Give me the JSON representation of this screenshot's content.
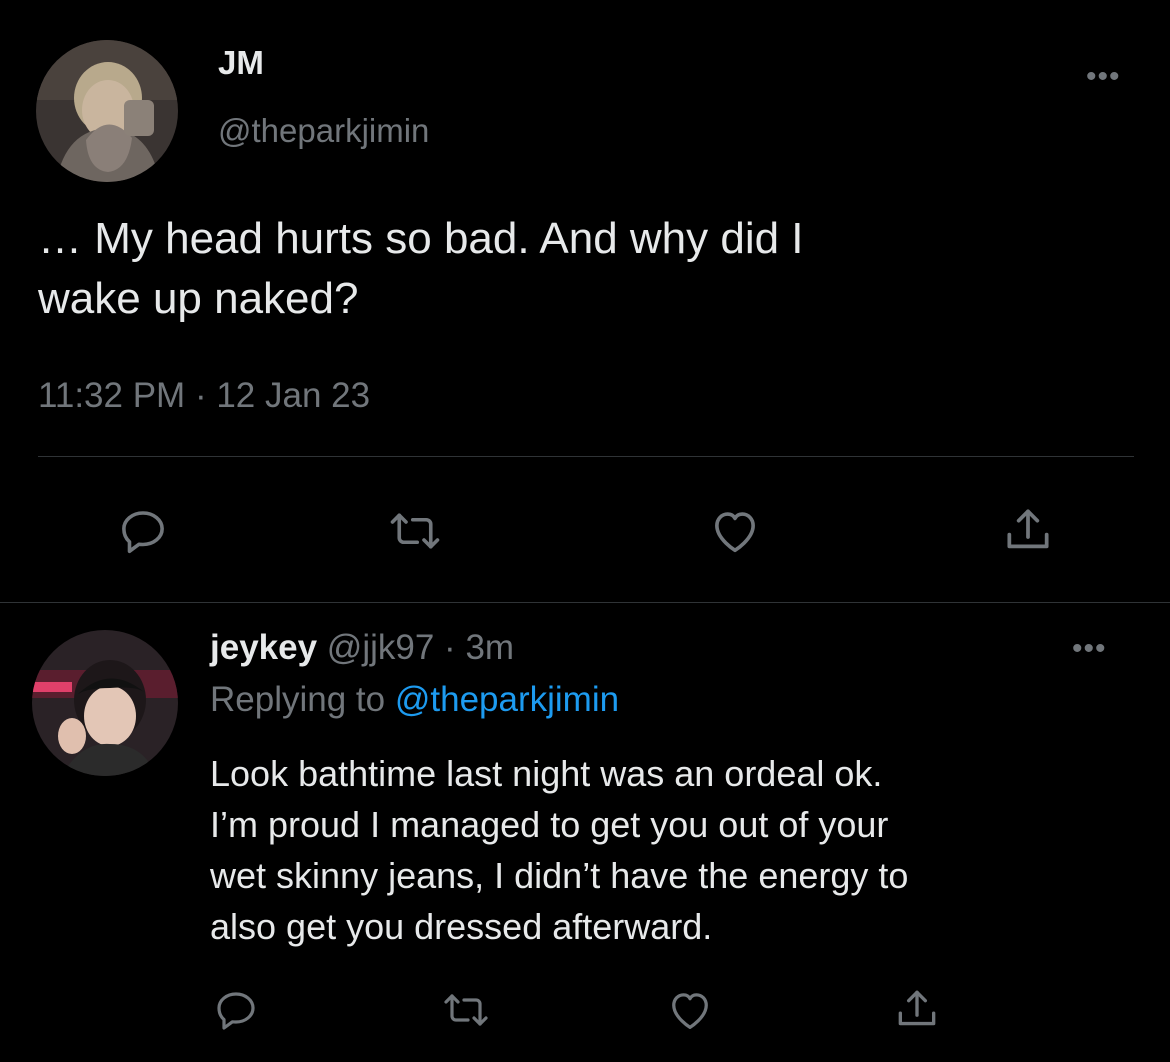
{
  "main_tweet": {
    "display_name": "JM",
    "handle": "@theparkjimin",
    "text_line1": "… My head hurts so bad. And why did I",
    "text_line2": "wake up naked?",
    "time": "11:32 PM",
    "separator": "·",
    "date": "12 Jan 23",
    "more_label": "•••"
  },
  "reply_tweet": {
    "display_name": "jeykey",
    "handle": "@jjk97",
    "separator": "·",
    "age": "3m",
    "replying_prefix": "Replying to",
    "replying_handle": "@theparkjimin",
    "text_lines": [
      "Look bathtime last night was an ordeal ok.",
      "I’m proud I managed to get you out of your",
      "wet skinny jeans, I didn’t have the energy to",
      "also get you dressed afterward."
    ],
    "more_label": "•••"
  },
  "icons": {
    "reply": "reply-bubble-icon",
    "retweet": "retweet-arrows-icon",
    "like": "heart-icon",
    "share": "share-upload-icon",
    "more": "more-dots-icon"
  },
  "colors": {
    "background": "#000000",
    "text": "#e7e9ea",
    "muted": "#71767b",
    "accent_link": "#1d9bf0",
    "divider": "#2f3336"
  }
}
